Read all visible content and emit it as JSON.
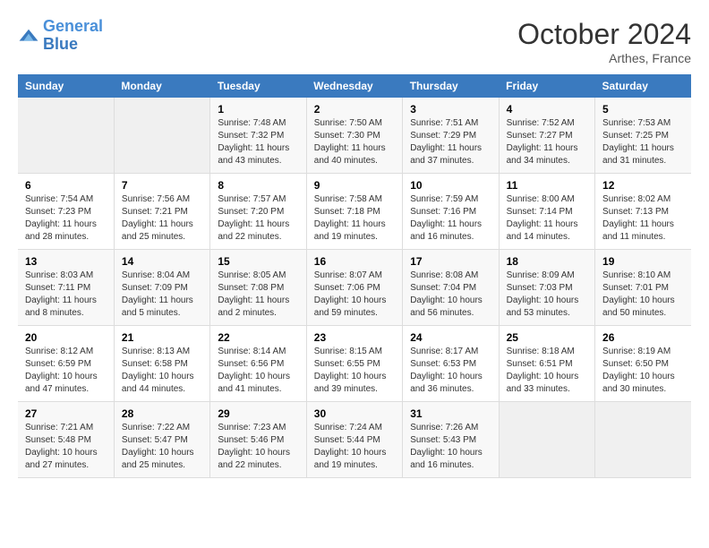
{
  "header": {
    "logo_line1": "General",
    "logo_line2": "Blue",
    "month": "October 2024",
    "location": "Arthes, France"
  },
  "weekdays": [
    "Sunday",
    "Monday",
    "Tuesday",
    "Wednesday",
    "Thursday",
    "Friday",
    "Saturday"
  ],
  "weeks": [
    [
      {
        "day": "",
        "sunrise": "",
        "sunset": "",
        "daylight": "",
        "empty": true
      },
      {
        "day": "",
        "sunrise": "",
        "sunset": "",
        "daylight": "",
        "empty": true
      },
      {
        "day": "1",
        "sunrise": "Sunrise: 7:48 AM",
        "sunset": "Sunset: 7:32 PM",
        "daylight": "Daylight: 11 hours and 43 minutes."
      },
      {
        "day": "2",
        "sunrise": "Sunrise: 7:50 AM",
        "sunset": "Sunset: 7:30 PM",
        "daylight": "Daylight: 11 hours and 40 minutes."
      },
      {
        "day": "3",
        "sunrise": "Sunrise: 7:51 AM",
        "sunset": "Sunset: 7:29 PM",
        "daylight": "Daylight: 11 hours and 37 minutes."
      },
      {
        "day": "4",
        "sunrise": "Sunrise: 7:52 AM",
        "sunset": "Sunset: 7:27 PM",
        "daylight": "Daylight: 11 hours and 34 minutes."
      },
      {
        "day": "5",
        "sunrise": "Sunrise: 7:53 AM",
        "sunset": "Sunset: 7:25 PM",
        "daylight": "Daylight: 11 hours and 31 minutes."
      }
    ],
    [
      {
        "day": "6",
        "sunrise": "Sunrise: 7:54 AM",
        "sunset": "Sunset: 7:23 PM",
        "daylight": "Daylight: 11 hours and 28 minutes."
      },
      {
        "day": "7",
        "sunrise": "Sunrise: 7:56 AM",
        "sunset": "Sunset: 7:21 PM",
        "daylight": "Daylight: 11 hours and 25 minutes."
      },
      {
        "day": "8",
        "sunrise": "Sunrise: 7:57 AM",
        "sunset": "Sunset: 7:20 PM",
        "daylight": "Daylight: 11 hours and 22 minutes."
      },
      {
        "day": "9",
        "sunrise": "Sunrise: 7:58 AM",
        "sunset": "Sunset: 7:18 PM",
        "daylight": "Daylight: 11 hours and 19 minutes."
      },
      {
        "day": "10",
        "sunrise": "Sunrise: 7:59 AM",
        "sunset": "Sunset: 7:16 PM",
        "daylight": "Daylight: 11 hours and 16 minutes."
      },
      {
        "day": "11",
        "sunrise": "Sunrise: 8:00 AM",
        "sunset": "Sunset: 7:14 PM",
        "daylight": "Daylight: 11 hours and 14 minutes."
      },
      {
        "day": "12",
        "sunrise": "Sunrise: 8:02 AM",
        "sunset": "Sunset: 7:13 PM",
        "daylight": "Daylight: 11 hours and 11 minutes."
      }
    ],
    [
      {
        "day": "13",
        "sunrise": "Sunrise: 8:03 AM",
        "sunset": "Sunset: 7:11 PM",
        "daylight": "Daylight: 11 hours and 8 minutes."
      },
      {
        "day": "14",
        "sunrise": "Sunrise: 8:04 AM",
        "sunset": "Sunset: 7:09 PM",
        "daylight": "Daylight: 11 hours and 5 minutes."
      },
      {
        "day": "15",
        "sunrise": "Sunrise: 8:05 AM",
        "sunset": "Sunset: 7:08 PM",
        "daylight": "Daylight: 11 hours and 2 minutes."
      },
      {
        "day": "16",
        "sunrise": "Sunrise: 8:07 AM",
        "sunset": "Sunset: 7:06 PM",
        "daylight": "Daylight: 10 hours and 59 minutes."
      },
      {
        "day": "17",
        "sunrise": "Sunrise: 8:08 AM",
        "sunset": "Sunset: 7:04 PM",
        "daylight": "Daylight: 10 hours and 56 minutes."
      },
      {
        "day": "18",
        "sunrise": "Sunrise: 8:09 AM",
        "sunset": "Sunset: 7:03 PM",
        "daylight": "Daylight: 10 hours and 53 minutes."
      },
      {
        "day": "19",
        "sunrise": "Sunrise: 8:10 AM",
        "sunset": "Sunset: 7:01 PM",
        "daylight": "Daylight: 10 hours and 50 minutes."
      }
    ],
    [
      {
        "day": "20",
        "sunrise": "Sunrise: 8:12 AM",
        "sunset": "Sunset: 6:59 PM",
        "daylight": "Daylight: 10 hours and 47 minutes."
      },
      {
        "day": "21",
        "sunrise": "Sunrise: 8:13 AM",
        "sunset": "Sunset: 6:58 PM",
        "daylight": "Daylight: 10 hours and 44 minutes."
      },
      {
        "day": "22",
        "sunrise": "Sunrise: 8:14 AM",
        "sunset": "Sunset: 6:56 PM",
        "daylight": "Daylight: 10 hours and 41 minutes."
      },
      {
        "day": "23",
        "sunrise": "Sunrise: 8:15 AM",
        "sunset": "Sunset: 6:55 PM",
        "daylight": "Daylight: 10 hours and 39 minutes."
      },
      {
        "day": "24",
        "sunrise": "Sunrise: 8:17 AM",
        "sunset": "Sunset: 6:53 PM",
        "daylight": "Daylight: 10 hours and 36 minutes."
      },
      {
        "day": "25",
        "sunrise": "Sunrise: 8:18 AM",
        "sunset": "Sunset: 6:51 PM",
        "daylight": "Daylight: 10 hours and 33 minutes."
      },
      {
        "day": "26",
        "sunrise": "Sunrise: 8:19 AM",
        "sunset": "Sunset: 6:50 PM",
        "daylight": "Daylight: 10 hours and 30 minutes."
      }
    ],
    [
      {
        "day": "27",
        "sunrise": "Sunrise: 7:21 AM",
        "sunset": "Sunset: 5:48 PM",
        "daylight": "Daylight: 10 hours and 27 minutes."
      },
      {
        "day": "28",
        "sunrise": "Sunrise: 7:22 AM",
        "sunset": "Sunset: 5:47 PM",
        "daylight": "Daylight: 10 hours and 25 minutes."
      },
      {
        "day": "29",
        "sunrise": "Sunrise: 7:23 AM",
        "sunset": "Sunset: 5:46 PM",
        "daylight": "Daylight: 10 hours and 22 minutes."
      },
      {
        "day": "30",
        "sunrise": "Sunrise: 7:24 AM",
        "sunset": "Sunset: 5:44 PM",
        "daylight": "Daylight: 10 hours and 19 minutes."
      },
      {
        "day": "31",
        "sunrise": "Sunrise: 7:26 AM",
        "sunset": "Sunset: 5:43 PM",
        "daylight": "Daylight: 10 hours and 16 minutes."
      },
      {
        "day": "",
        "sunrise": "",
        "sunset": "",
        "daylight": "",
        "empty": true
      },
      {
        "day": "",
        "sunrise": "",
        "sunset": "",
        "daylight": "",
        "empty": true
      }
    ]
  ]
}
